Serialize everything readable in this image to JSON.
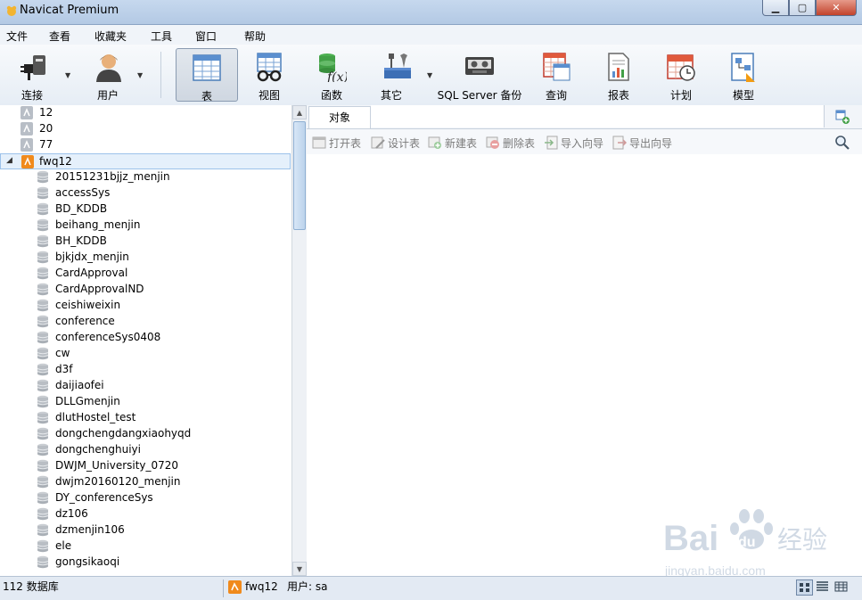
{
  "window": {
    "title": "Navicat Premium"
  },
  "menu": [
    "文件",
    "查看",
    "收藏夹",
    "工具",
    "窗口",
    "帮助"
  ],
  "toolbar": {
    "connect": "连接",
    "user": "用户",
    "table": "表",
    "view": "视图",
    "function": "函数",
    "other": "其它",
    "backup": "SQL Server 备份",
    "query": "查询",
    "report": "报表",
    "schedule": "计划",
    "model": "模型"
  },
  "tree": {
    "servers": [
      "12",
      "20",
      "77"
    ],
    "selected_server": "fwq12",
    "databases": [
      "20151231bjjz_menjin",
      "accessSys",
      "BD_KDDB",
      "beihang_menjin",
      "BH_KDDB",
      "bjkjdx_menjin",
      "CardApproval",
      "CardApprovalND",
      "ceishiweixin",
      "conference",
      "conferenceSys0408",
      "cw",
      "d3f",
      "daijiaofei",
      "DLLGmenjin",
      "dlutHostel_test",
      "dongchengdangxiaohyqd",
      "dongchenghuiyi",
      "DWJM_University_0720",
      "dwjm20160120_menjin",
      "DY_conferenceSys",
      "dz106",
      "dzmenjin106",
      "ele",
      "gongsikaoqi"
    ]
  },
  "objects": {
    "tab": "对象",
    "open_table": "打开表",
    "design_table": "设计表",
    "new_table": "新建表",
    "delete_table": "删除表",
    "import_wizard": "导入向导",
    "export_wizard": "导出向导"
  },
  "status": {
    "db_count": "112 数据库",
    "connection": "fwq12",
    "user": "用户: sa"
  },
  "watermark": {
    "brand": "Bai",
    "brand2": "du",
    "cn": "经验",
    "url": "jingyan.baidu.com"
  }
}
